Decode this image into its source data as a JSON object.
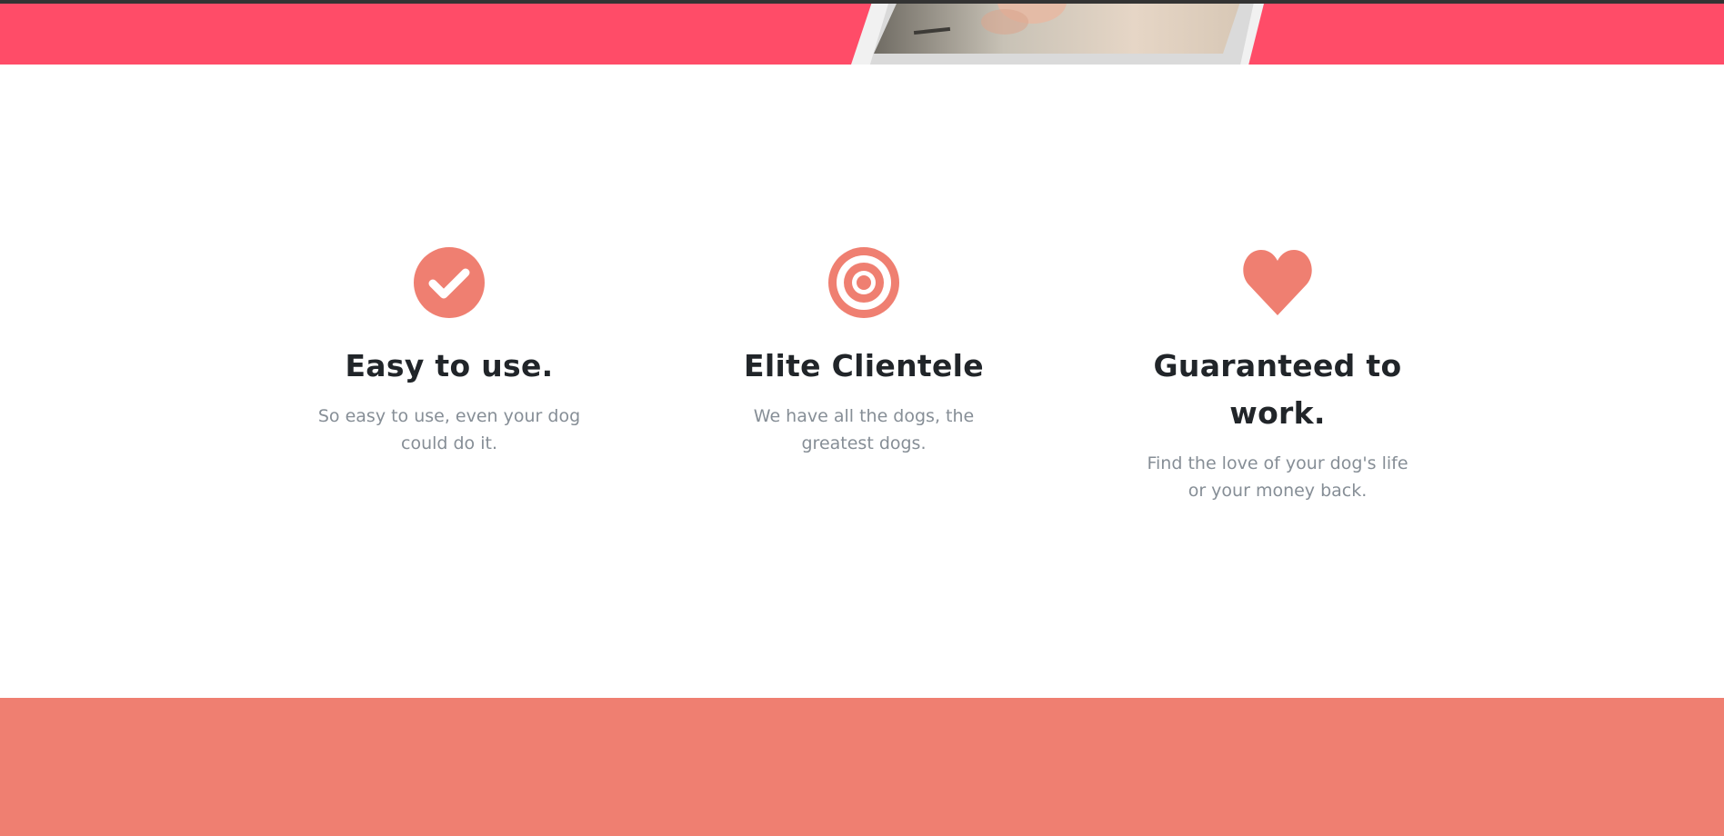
{
  "colors": {
    "hero_band": "#ff4c68",
    "accent": "#ef7f71",
    "heading": "#212529",
    "muted_text": "#868e96"
  },
  "features": [
    {
      "icon": "check-circle-icon",
      "title": "Easy to use.",
      "text": "So easy to use, even your dog could do it."
    },
    {
      "icon": "bullseye-icon",
      "title": "Elite Clientele",
      "text": "We have all the dogs, the greatest dogs."
    },
    {
      "icon": "heart-icon",
      "title": "Guaranteed to work.",
      "text": "Find the love of your dog's life or your money back."
    }
  ]
}
